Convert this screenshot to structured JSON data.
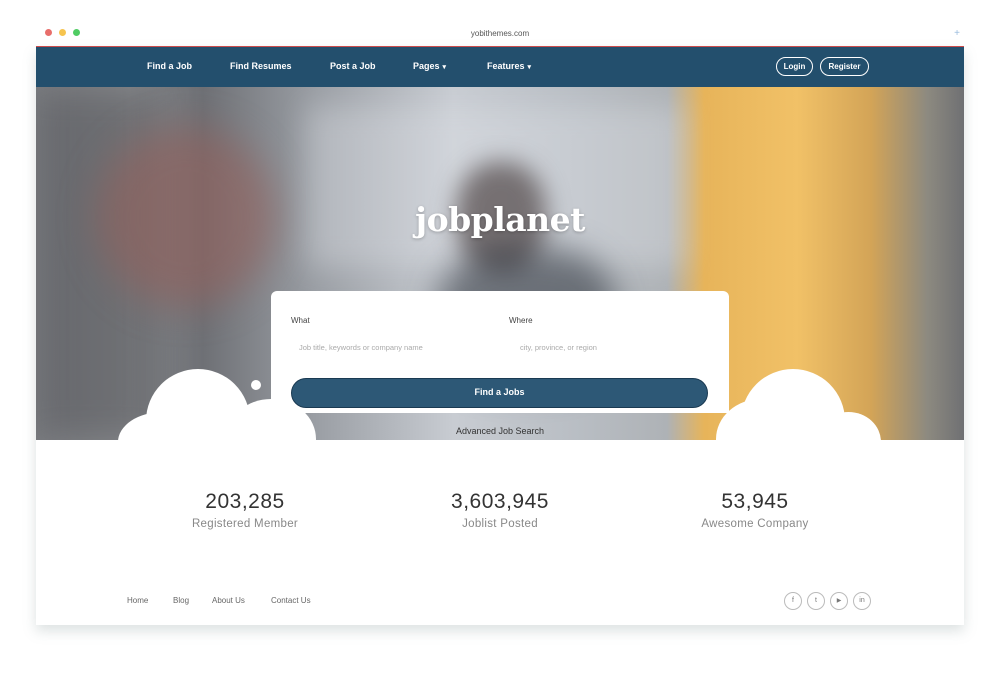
{
  "browser": {
    "url": "yobithemes.com",
    "dot_colors": [
      "#e86e6b",
      "#f6c44f",
      "#4fcc63"
    ]
  },
  "nav": {
    "items": [
      {
        "label": "Find a Job",
        "has_caret": false
      },
      {
        "label": "Find Resumes",
        "has_caret": false
      },
      {
        "label": "Post a Job",
        "has_caret": false
      },
      {
        "label": "Pages",
        "has_caret": true
      },
      {
        "label": "Features",
        "has_caret": true
      }
    ],
    "login_label": "Login",
    "register_label": "Register",
    "bg_color": "#234f6d"
  },
  "hero": {
    "logo_text": "jobplanet"
  },
  "search": {
    "what_label": "What",
    "what_placeholder": "Job title, keywords or company name",
    "where_label": "Where",
    "where_placeholder": "city, province, or region",
    "button_label": "Find a Jobs",
    "advanced_link": "Advanced Job Search"
  },
  "stats": [
    {
      "value": "203,285",
      "label": "Registered Member"
    },
    {
      "value": "3,603,945",
      "label": "Joblist Posted"
    },
    {
      "value": "53,945",
      "label": "Awesome Company"
    }
  ],
  "footer": {
    "links": [
      "Home",
      "Blog",
      "About Us",
      "Contact Us"
    ],
    "social": [
      {
        "icon": "facebook-icon",
        "glyph": "f"
      },
      {
        "icon": "twitter-icon",
        "glyph": "t"
      },
      {
        "icon": "youtube-icon",
        "glyph": "▶"
      },
      {
        "icon": "linkedin-icon",
        "glyph": "in"
      }
    ]
  }
}
